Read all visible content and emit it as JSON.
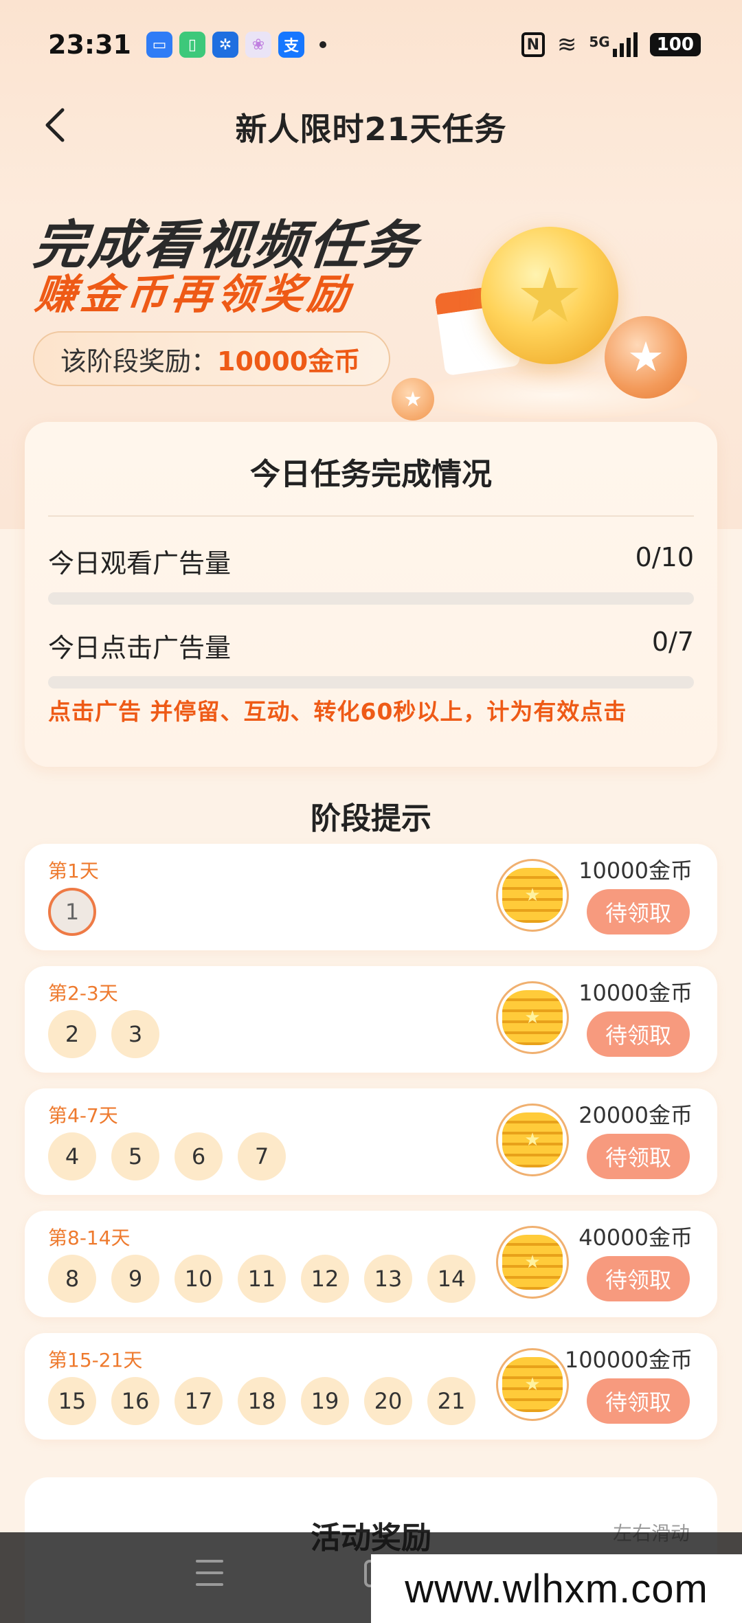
{
  "status_bar": {
    "time": "23:31",
    "network": "5G",
    "battery": "100"
  },
  "header": {
    "title": "新人限时21天任务"
  },
  "banner": {
    "line1": "完成看视频任务",
    "line2": "赚金币再领奖励",
    "reward_label": "该阶段奖励：",
    "reward_amount": "10000金币"
  },
  "today": {
    "title": "今日任务完成情况",
    "watch_label": "今日观看广告量",
    "watch_value": "0/10",
    "watch_progress": 0,
    "click_label": "今日点击广告量",
    "click_value": "0/7",
    "click_progress": 0,
    "note": "点击广告 并停留、互动、转化60秒以上，计为有效点击"
  },
  "stages_title": "阶段提示",
  "stages": [
    {
      "label": "第1天",
      "days": [
        "1"
      ],
      "amount": "10000金币",
      "button": "待领取"
    },
    {
      "label": "第2-3天",
      "days": [
        "2",
        "3"
      ],
      "amount": "10000金币",
      "button": "待领取"
    },
    {
      "label": "第4-7天",
      "days": [
        "4",
        "5",
        "6",
        "7"
      ],
      "amount": "20000金币",
      "button": "待领取"
    },
    {
      "label": "第8-14天",
      "days": [
        "8",
        "9",
        "10",
        "11",
        "12",
        "13",
        "14"
      ],
      "amount": "40000金币",
      "button": "待领取"
    },
    {
      "label": "第15-21天",
      "days": [
        "15",
        "16",
        "17",
        "18",
        "19",
        "20",
        "21"
      ],
      "amount": "100000金币",
      "button": "待领取"
    }
  ],
  "activity": {
    "title": "活动奖励",
    "hint": "左右滑动"
  },
  "watermark": "www.wlhxm.com",
  "colors": {
    "accent": "#ee5a16",
    "claim_button": "#f79a7e",
    "day_bubble": "#fde9c9"
  },
  "icons": {
    "back": "chevron-left-icon",
    "coin": "coin-stack-icon"
  }
}
